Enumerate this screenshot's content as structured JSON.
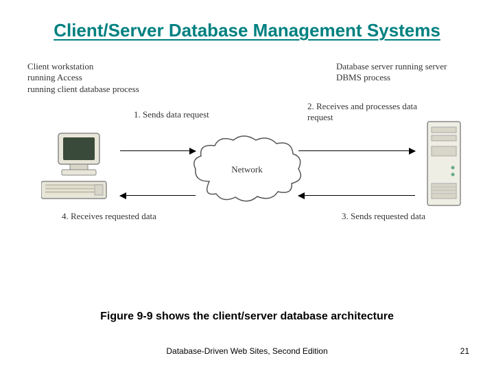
{
  "title": "Client/Server Database Management Systems",
  "client_label": "Client workstation\nrunning Access\nrunning client database process",
  "server_label": "Database server running server DBMS process",
  "step1": "1. Sends data request",
  "step2": "2. Receives and processes data request",
  "step3": "3. Sends requested data",
  "step4": "4. Receives requested data",
  "network_label": "Network",
  "caption": "Figure 9-9 shows the client/server database architecture",
  "footer_left": "Database-Driven Web Sites, Second Edition",
  "footer_right": "21"
}
